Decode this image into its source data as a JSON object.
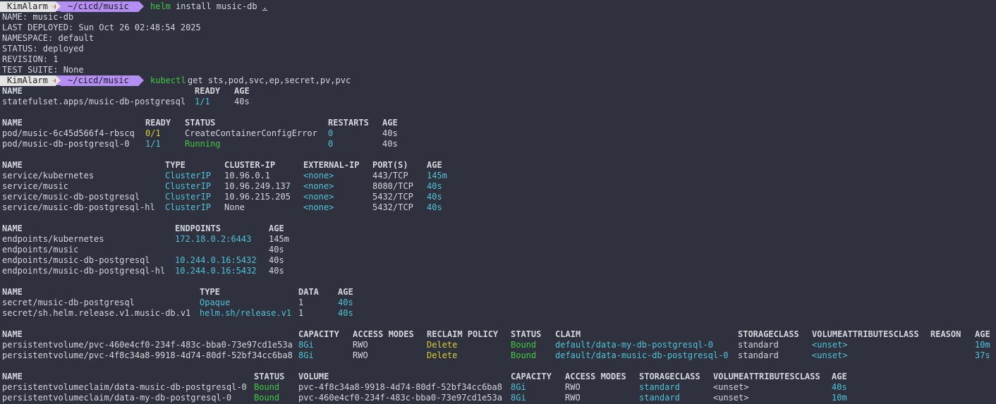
{
  "colors": {
    "background": "#2f323e",
    "text": "#d3d6dd",
    "cyan": "#4cc4d6",
    "green": "#3ec93e",
    "yellow": "#d6cf2e",
    "prompt_user_bg": "#e4e4e4",
    "prompt_path_bg": "#b48ef0"
  },
  "prompts": [
    {
      "user": "KimAlarm",
      "icon": "rocket-icon",
      "path": "~/cicd/music",
      "command": "helm",
      "args": "install music-db ."
    },
    {
      "user": "KimAlarm",
      "icon": "rocket-icon",
      "path": "~/cicd/music",
      "command": "kubectl",
      "args": "get sts,pod,svc,ep,secret,pv,pvc"
    }
  ],
  "helm_output": [
    "NAME: music-db",
    "LAST DEPLOYED: Sun Oct 26 02:48:54 2025",
    "NAMESPACE: default",
    "STATUS: deployed",
    "REVISION: 1",
    "TEST SUITE: None"
  ],
  "sts": {
    "headers": [
      "NAME",
      "READY",
      "AGE"
    ],
    "rows": [
      [
        "statefulset.apps/music-db-postgresql",
        "1/1",
        "40s"
      ]
    ]
  },
  "pods": {
    "headers": [
      "NAME",
      "READY",
      "STATUS",
      "RESTARTS",
      "AGE"
    ],
    "rows": [
      [
        "pod/music-6c45d566f4-rbscq",
        "0/1",
        "CreateContainerConfigError",
        "0",
        "40s"
      ],
      [
        "pod/music-db-postgresql-0",
        "1/1",
        "Running",
        "0",
        "40s"
      ]
    ]
  },
  "svc": {
    "headers": [
      "NAME",
      "TYPE",
      "CLUSTER-IP",
      "EXTERNAL-IP",
      "PORT(S)",
      "AGE"
    ],
    "rows": [
      [
        "service/kubernetes",
        "ClusterIP",
        "10.96.0.1",
        "<none>",
        "443/TCP",
        "145m"
      ],
      [
        "service/music",
        "ClusterIP",
        "10.96.249.137",
        "<none>",
        "8080/TCP",
        "40s"
      ],
      [
        "service/music-db-postgresql",
        "ClusterIP",
        "10.96.215.205",
        "<none>",
        "5432/TCP",
        "40s"
      ],
      [
        "service/music-db-postgresql-hl",
        "ClusterIP",
        "None",
        "<none>",
        "5432/TCP",
        "40s"
      ]
    ]
  },
  "ep": {
    "headers": [
      "NAME",
      "ENDPOINTS",
      "AGE"
    ],
    "rows": [
      [
        "endpoints/kubernetes",
        "172.18.0.2:6443",
        "145m"
      ],
      [
        "endpoints/music",
        "",
        "40s"
      ],
      [
        "endpoints/music-db-postgresql",
        "10.244.0.16:5432",
        "40s"
      ],
      [
        "endpoints/music-db-postgresql-hl",
        "10.244.0.16:5432",
        "40s"
      ]
    ]
  },
  "secret": {
    "headers": [
      "NAME",
      "TYPE",
      "DATA",
      "AGE"
    ],
    "rows": [
      [
        "secret/music-db-postgresql",
        "Opaque",
        "1",
        "40s"
      ],
      [
        "secret/sh.helm.release.v1.music-db.v1",
        "helm.sh/release.v1",
        "1",
        "40s"
      ]
    ]
  },
  "pv": {
    "headers": [
      "NAME",
      "CAPACITY",
      "ACCESS MODES",
      "RECLAIM POLICY",
      "STATUS",
      "CLAIM",
      "STORAGECLASS",
      "VOLUMEATTRIBUTESCLASS",
      "REASON",
      "AGE"
    ],
    "rows": [
      [
        "persistentvolume/pvc-460e4cf0-234f-483c-bba0-73e97cd1e53a",
        "8Gi",
        "RWO",
        "Delete",
        "Bound",
        "default/data-my-db-postgresql-0",
        "standard",
        "<unset>",
        "",
        "10m"
      ],
      [
        "persistentvolume/pvc-4f8c34a8-9918-4d74-80df-52bf34cc6ba8",
        "8Gi",
        "RWO",
        "Delete",
        "Bound",
        "default/data-music-db-postgresql-0",
        "standard",
        "<unset>",
        "",
        "37s"
      ]
    ]
  },
  "pvc": {
    "headers": [
      "NAME",
      "STATUS",
      "VOLUME",
      "CAPACITY",
      "ACCESS MODES",
      "STORAGECLASS",
      "VOLUMEATTRIBUTESCLASS",
      "AGE"
    ],
    "rows": [
      [
        "persistentvolumeclaim/data-music-db-postgresql-0",
        "Bound",
        "pvc-4f8c34a8-9918-4d74-80df-52bf34cc6ba8",
        "8Gi",
        "RWO",
        "standard",
        "<unset>",
        "40s"
      ],
      [
        "persistentvolumeclaim/data-my-db-postgresql-0",
        "Bound",
        "pvc-460e4cf0-234f-483c-bba0-73e97cd1e53a",
        "8Gi",
        "RWO",
        "standard",
        "<unset>",
        "10m"
      ]
    ]
  }
}
